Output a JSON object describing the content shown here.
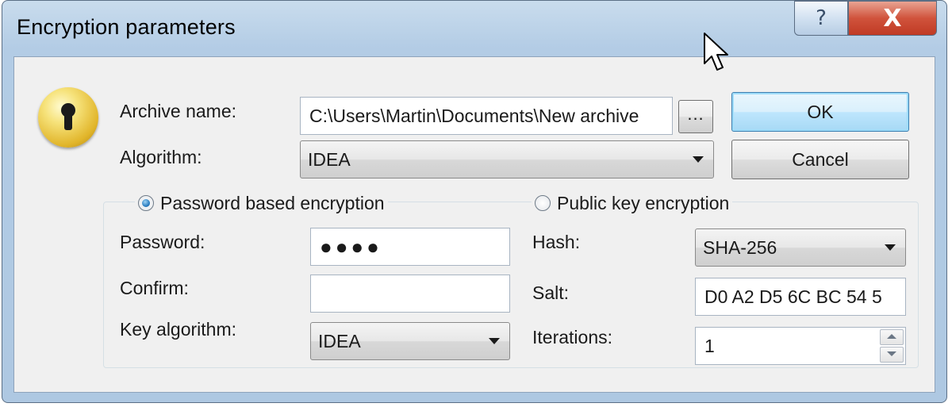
{
  "window": {
    "title": "Encryption parameters",
    "help_glyph": "?",
    "close_glyph": "X"
  },
  "archive": {
    "label": "Archive name:",
    "value": "C:\\Users\\Martin\\Documents\\New archive",
    "browse_label": "..."
  },
  "algorithm": {
    "label": "Algorithm:",
    "value": "IDEA"
  },
  "buttons": {
    "ok_label": "OK",
    "cancel_label": "Cancel"
  },
  "password_mode": {
    "label": "Password based encryption",
    "selected": true,
    "password_label": "Password:",
    "password_mask": "●●●●",
    "confirm_label": "Confirm:",
    "confirm_value": "",
    "key_algorithm_label": "Key algorithm:",
    "key_algorithm_value": "IDEA"
  },
  "public_key_mode": {
    "label": "Public key encryption",
    "selected": false,
    "hash_label": "Hash:",
    "hash_value": "SHA-256",
    "salt_label": "Salt:",
    "salt_value": "D0 A2 D5 6C BC 54 5",
    "iterations_label": "Iterations:",
    "iterations_value": "1"
  },
  "icons": {
    "dialog_icon": "lock-icon",
    "help_icon": "help-icon",
    "close_icon": "close-icon",
    "cursor": "mouse-pointer-icon"
  },
  "colors": {
    "title_bar": "#b9d1ea",
    "client_background": "#f0f0f0",
    "close_button": "#c8442e",
    "default_button_glow": "#9fdcf8",
    "radio_selected": "#2d7fc1"
  }
}
